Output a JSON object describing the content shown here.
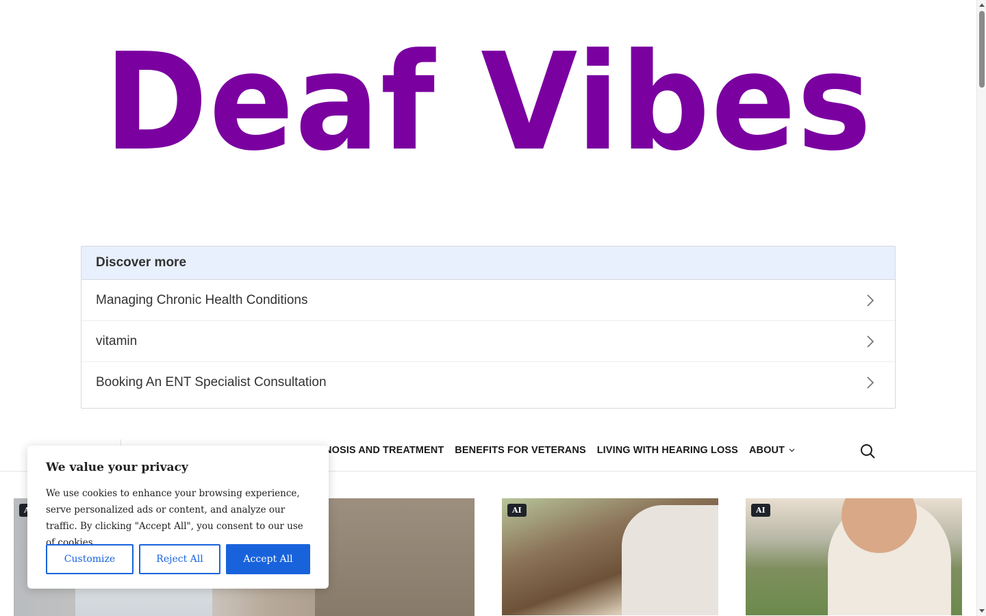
{
  "site": {
    "logo_text": "Deaf Vibes",
    "logo_color": "#7a00a0"
  },
  "discover": {
    "heading": "Discover more",
    "items": [
      {
        "label": "Managing Chronic Health Conditions",
        "icon": "chevron-right-icon"
      },
      {
        "label": "vitamin",
        "icon": "chevron-right-icon"
      },
      {
        "label": "Booking An ENT Specialist Consultation",
        "icon": "chevron-right-icon"
      }
    ]
  },
  "nav": {
    "items": [
      {
        "label": "NOSIS AND TREATMENT"
      },
      {
        "label": "BENEFITS FOR VETERANS"
      },
      {
        "label": "LIVING WITH HEARING LOSS"
      },
      {
        "label": "ABOUT",
        "icon": "chevron-down-icon"
      }
    ],
    "search_icon": "search-icon"
  },
  "cards": [
    {
      "badge": "A"
    },
    {
      "badge": "AI"
    },
    {
      "badge": "AI"
    }
  ],
  "cookie": {
    "title": "We value your privacy",
    "text": "We use cookies to enhance your browsing experience, serve personalized ads or content, and analyze our traffic. By clicking \"Accept All\", you consent to our use of cookies.",
    "customize_label": "Customize",
    "reject_label": "Reject All",
    "accept_label": "Accept All",
    "accent_color": "#1863dc"
  }
}
